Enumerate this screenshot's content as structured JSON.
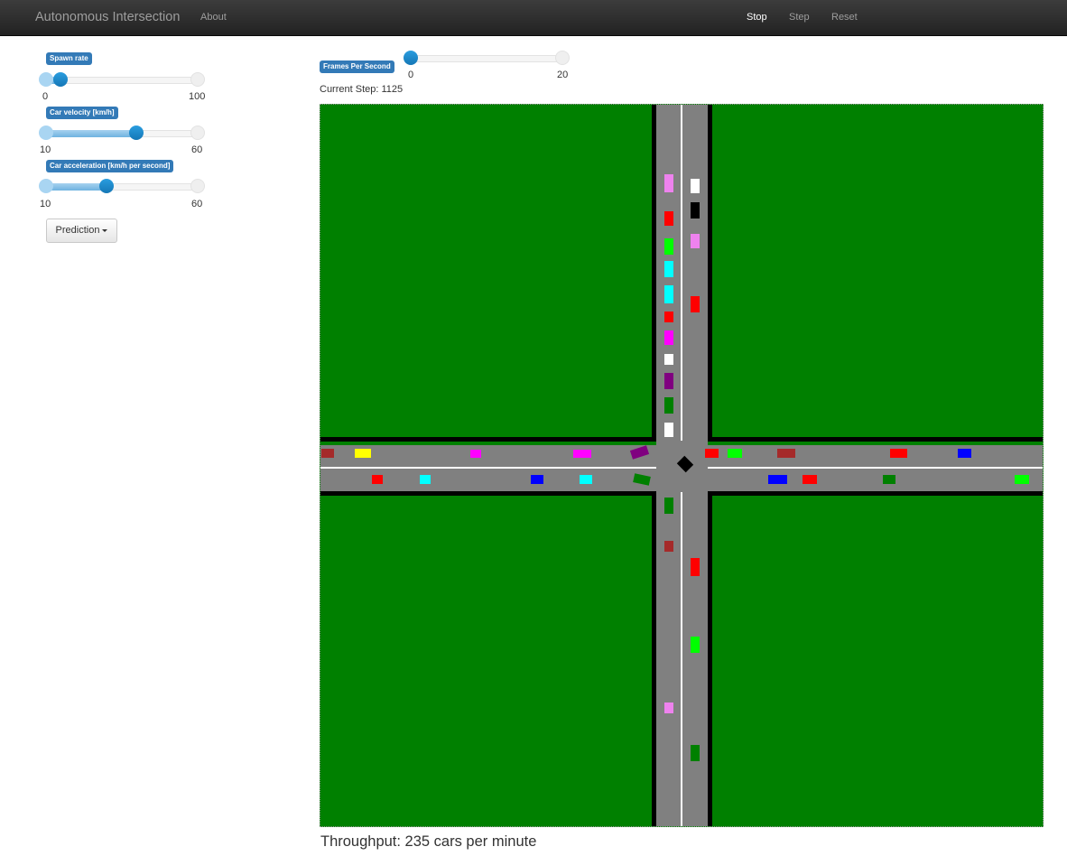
{
  "navbar": {
    "brand": "Autonomous Intersection",
    "about": "About",
    "stop": "Stop",
    "step": "Step",
    "reset": "Reset"
  },
  "sliders": {
    "spawn_rate": {
      "label": "Spawn rate",
      "min": "0",
      "max": "100",
      "value": 10
    },
    "car_velocity": {
      "label": "Car velocity [km/h]",
      "min": "10",
      "max": "60",
      "value": 40
    },
    "car_acceleration": {
      "label": "Car acceleration [km/h per second]",
      "min": "10",
      "max": "60",
      "value": 24
    },
    "fps": {
      "label": "Frames Per Second",
      "min": "0",
      "max": "20",
      "value": 0
    }
  },
  "prediction_dropdown": {
    "label": "Prediction"
  },
  "status": {
    "current_step": "Current Step: 1125",
    "throughput": "Throughput: 235 cars per minute"
  },
  "colors": {
    "grass": "#008000",
    "road": "#808080",
    "curb": "#000000",
    "lane_marking": "#ffffff",
    "accent": "#337ab7"
  },
  "cars": [
    {
      "color": "#ee82ee"
    },
    {
      "color": "#ff0000"
    },
    {
      "color": "#00ff00"
    },
    {
      "color": "#00ffff"
    },
    {
      "color": "#00ffff"
    },
    {
      "color": "#ff0000"
    },
    {
      "color": "#ff00ff"
    },
    {
      "color": "#ffffff"
    },
    {
      "color": "#800080"
    },
    {
      "color": "#008000"
    },
    {
      "color": "#ffffff"
    },
    {
      "color": "#ffffff"
    },
    {
      "color": "#000000"
    },
    {
      "color": "#ee82ee"
    },
    {
      "color": "#ff0000"
    },
    {
      "color": "#a52a2a"
    },
    {
      "color": "#ffff00"
    },
    {
      "color": "#ff00ff"
    },
    {
      "color": "#ff00ff"
    },
    {
      "color": "#800080"
    },
    {
      "color": "#ff0000"
    },
    {
      "color": "#00ffff"
    },
    {
      "color": "#0000ff"
    },
    {
      "color": "#00ffff"
    },
    {
      "color": "#008000"
    },
    {
      "color": "#000000"
    },
    {
      "color": "#ff0000"
    },
    {
      "color": "#00ff00"
    },
    {
      "color": "#a52a2a"
    },
    {
      "color": "#ff0000"
    },
    {
      "color": "#0000ff"
    },
    {
      "color": "#0000ff"
    },
    {
      "color": "#ff0000"
    },
    {
      "color": "#008000"
    },
    {
      "color": "#00ff00"
    },
    {
      "color": "#008000"
    },
    {
      "color": "#a52a2a"
    },
    {
      "color": "#ee82ee"
    },
    {
      "color": "#ff0000"
    },
    {
      "color": "#00ff00"
    },
    {
      "color": "#008000"
    }
  ]
}
